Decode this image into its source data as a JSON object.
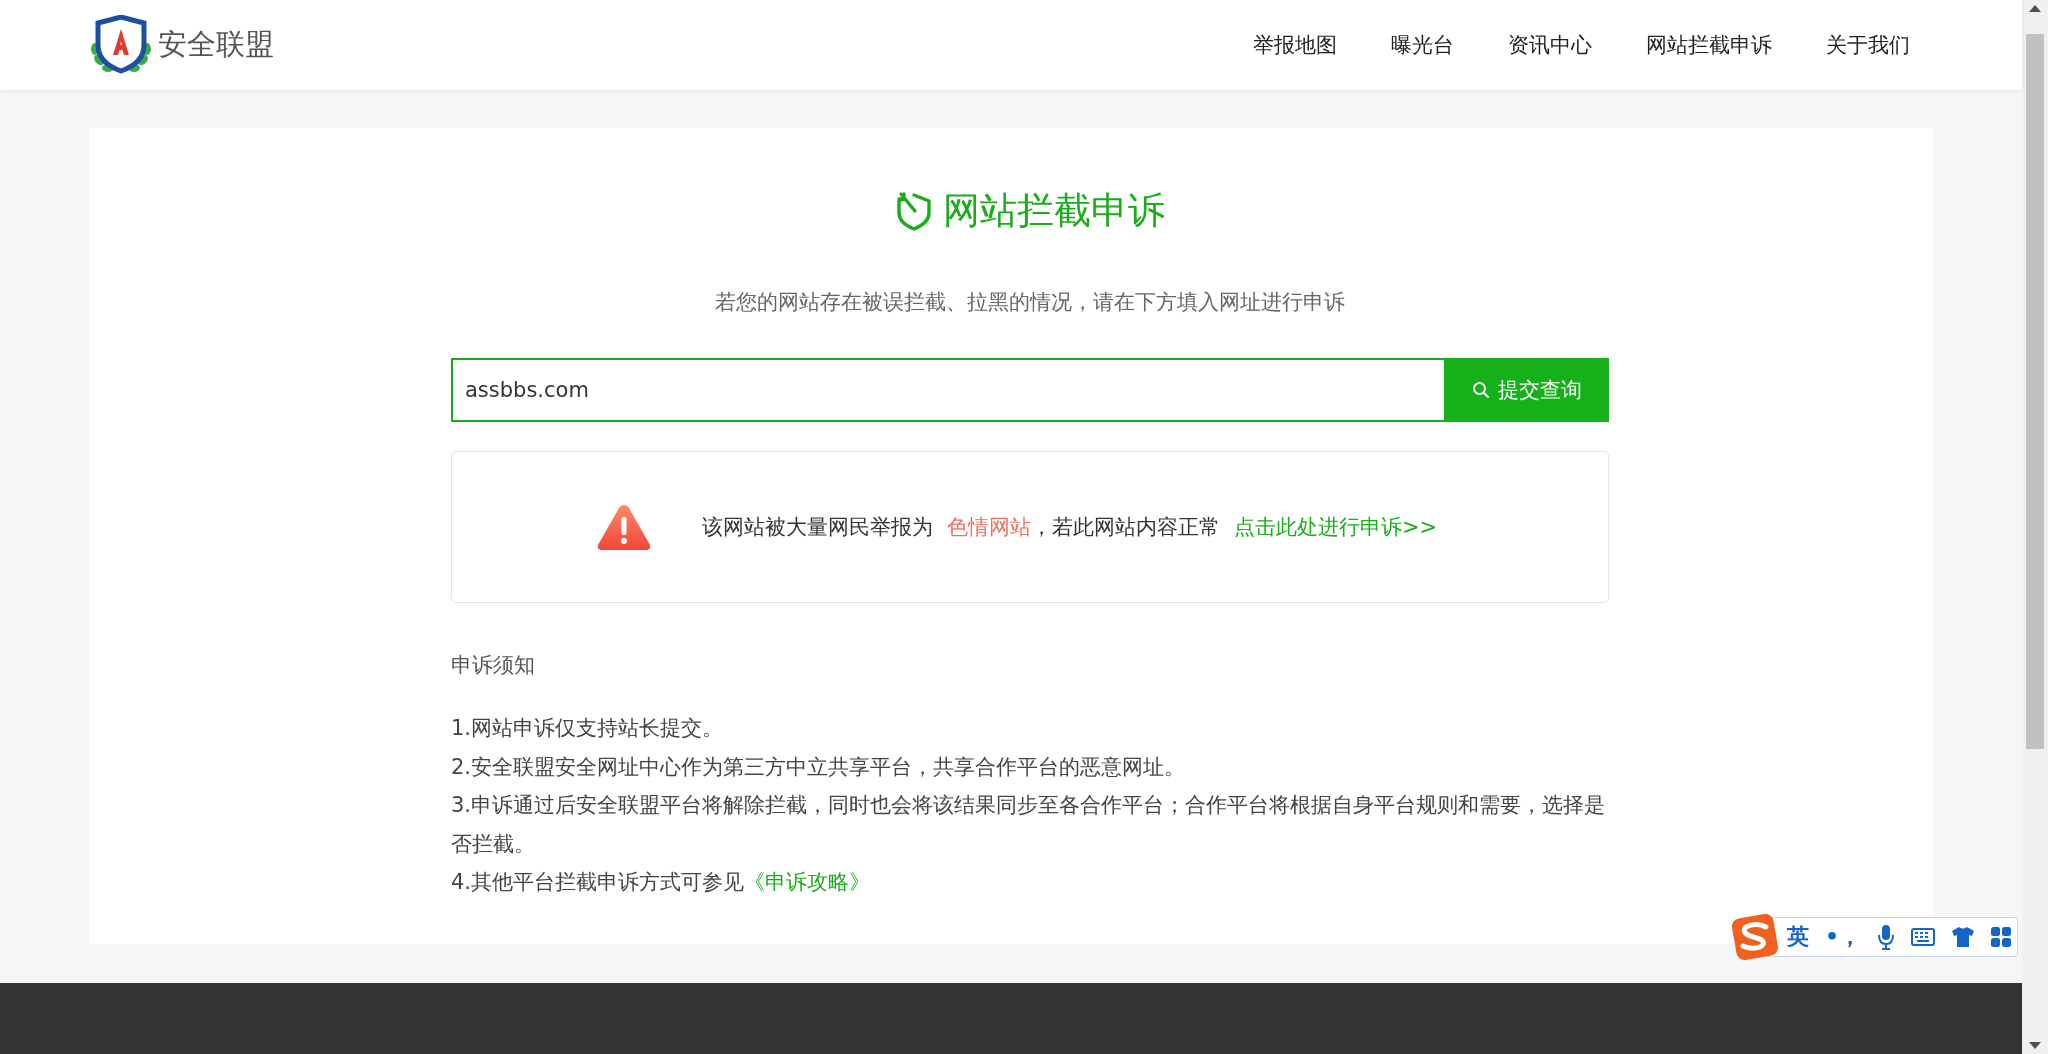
{
  "header": {
    "logo_text": "安全联盟",
    "nav": [
      "举报地图",
      "曝光台",
      "资讯中心",
      "网站拦截申诉",
      "关于我们"
    ]
  },
  "appeal": {
    "title": "网站拦截申诉",
    "subtitle": "若您的网站存在被误拦截、拉黑的情况，请在下方填入网址进行申诉",
    "search": {
      "value": "assbbs.com",
      "button": "提交查询"
    },
    "result": {
      "prefix": "该网站被大量网民举报为",
      "category": "色情网站",
      "middle": "，若此网站内容正常",
      "link": "点击此处进行申诉>>"
    },
    "notice": {
      "heading": "申诉须知",
      "items": [
        {
          "text": "1.网站申诉仅支持站长提交。"
        },
        {
          "text": "2.安全联盟安全网址中心作为第三方中立共享平台，共享合作平台的恶意网址。"
        },
        {
          "text": "3.申诉通过后安全联盟平台将解除拦截，同时也会将该结果同步至各合作平台；合作平台将根据自身平台规则和需要，选择是否拦截。"
        },
        {
          "text": "4.其他平台拦截申诉方式可参见",
          "link": "《申诉攻略》"
        }
      ]
    }
  },
  "ime": {
    "mode": "英",
    "punctuation": "•，"
  }
}
